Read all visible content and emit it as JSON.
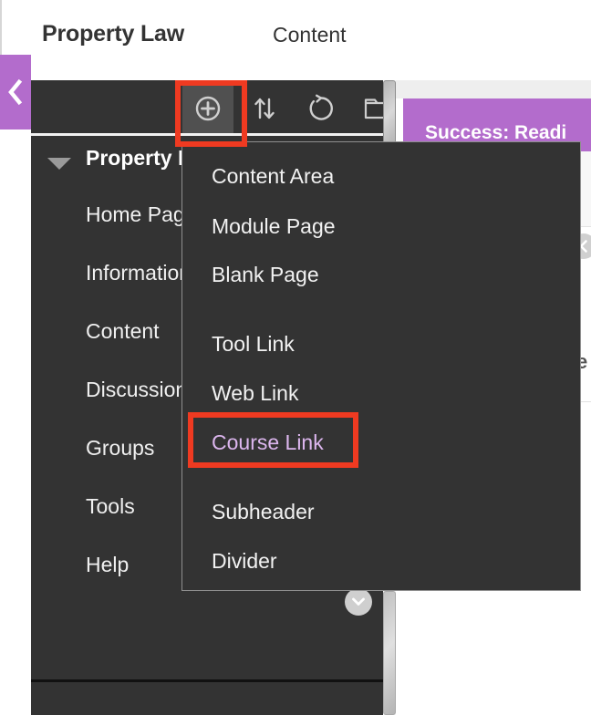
{
  "header": {
    "course_title": "Property Law",
    "breadcrumb_page": "Content"
  },
  "content_pane": {
    "success_banner_text": "Success: Readi",
    "fragment_text": "e",
    "collapse_right_icon": "chevron-left-icon",
    "banner_color": "#b36ccc"
  },
  "purple_tab": {
    "icon": "chevron-left-icon",
    "color": "#b36ccc"
  },
  "toolbar": {
    "buttons": [
      {
        "name": "add-content-button",
        "icon": "plus-circle-icon",
        "active": true
      },
      {
        "name": "reorder-button",
        "icon": "up-down-arrows-icon",
        "active": false
      },
      {
        "name": "refresh-button",
        "icon": "refresh-circle-icon",
        "active": false
      },
      {
        "name": "folder-button",
        "icon": "folder-icon",
        "active": false
      }
    ]
  },
  "course_menu": {
    "root_label": "Property Law",
    "expand_icon": "triangle-down-icon",
    "items": [
      {
        "label": "Home Page"
      },
      {
        "label": "Information"
      },
      {
        "label": "Content"
      },
      {
        "label": "Discussions"
      },
      {
        "label": "Groups"
      },
      {
        "label": "Tools"
      },
      {
        "label": "Help"
      }
    ],
    "scroll_down_icon": "chevron-down-circle-icon",
    "background_color": "#333333"
  },
  "dropdown": {
    "groups": [
      {
        "items": [
          {
            "label": "Content Area",
            "highlighted": false
          },
          {
            "label": "Module Page",
            "highlighted": false
          },
          {
            "label": "Blank Page",
            "highlighted": false
          }
        ]
      },
      {
        "items": [
          {
            "label": "Tool Link",
            "highlighted": false
          },
          {
            "label": "Web Link",
            "highlighted": false
          },
          {
            "label": "Course Link",
            "highlighted": true
          }
        ]
      },
      {
        "items": [
          {
            "label": "Subheader",
            "highlighted": false
          },
          {
            "label": "Divider",
            "highlighted": false
          }
        ]
      }
    ],
    "background_color": "#333333",
    "highlight_text_color": "#dcb6ee"
  },
  "annotations": {
    "color": "#ef3a21",
    "boxes": [
      {
        "name": "annotation-add-content",
        "target": "add-content-button"
      },
      {
        "name": "annotation-course-link",
        "target": "dropdown-item-course-link"
      }
    ]
  }
}
